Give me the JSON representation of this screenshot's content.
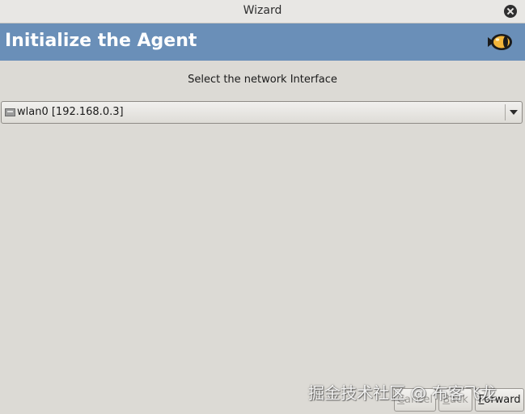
{
  "window": {
    "title": "Wizard",
    "close_icon": "close-icon"
  },
  "banner": {
    "title": "Initialize the Agent",
    "logo_icon": "cat-eye-logo-icon",
    "color": "#6a8fb8"
  },
  "main": {
    "prompt": "Select the network Interface",
    "interface_select": {
      "selected": "wlan0 [192.168.0.3]",
      "icon": "network-card-icon"
    }
  },
  "footer": {
    "cancel_first": "C",
    "cancel_rest": "ancel",
    "back_first": "B",
    "back_rest": "ack",
    "forward_first": "F",
    "forward_rest": "orward"
  },
  "watermark": {
    "text": "掘金技术社区 @ 布客飞龙"
  }
}
